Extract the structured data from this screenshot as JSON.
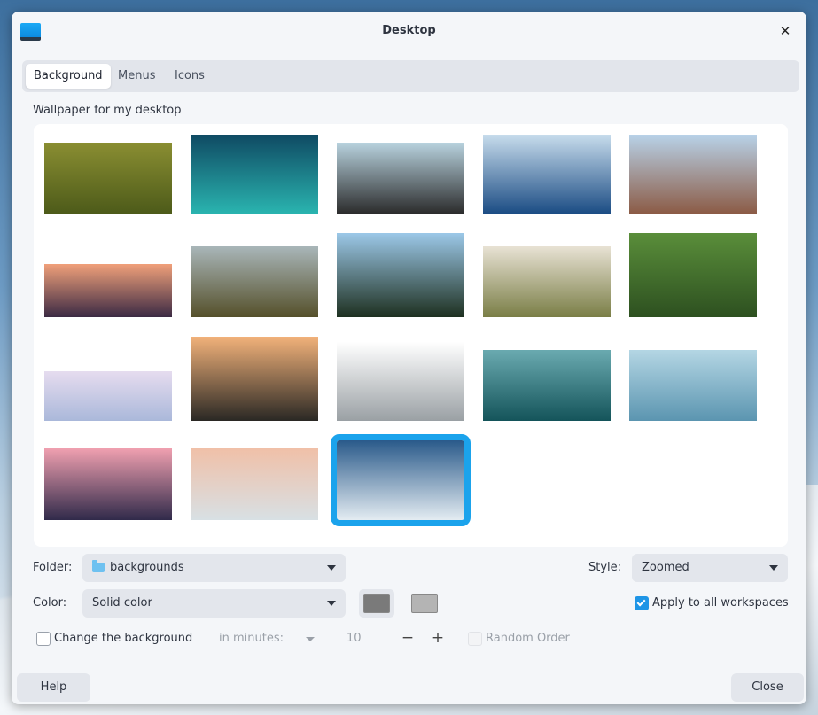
{
  "window": {
    "title": "Desktop",
    "close_glyph": "✕"
  },
  "tabs": [
    {
      "label": "Background",
      "active": true
    },
    {
      "label": "Menus",
      "active": false
    },
    {
      "label": "Icons",
      "active": false
    }
  ],
  "gallery": {
    "label": "Wallpaper for my desktop",
    "selected_index": 17,
    "thumbnails": [
      {
        "name": "green-valley-river",
        "colors": [
          "#8a8e32",
          "#4c5a19"
        ]
      },
      {
        "name": "aurora",
        "colors": [
          "#0f4a63",
          "#2ab5b0"
        ]
      },
      {
        "name": "black-sand-beach",
        "colors": [
          "#b8d2de",
          "#2a2a2a"
        ]
      },
      {
        "name": "ocean-horizon",
        "colors": [
          "#c7dcec",
          "#1a4b83"
        ]
      },
      {
        "name": "desert-buttes-snow",
        "colors": [
          "#b8d2e8",
          "#8b5a44"
        ]
      },
      {
        "name": "city-skyline-sunset",
        "colors": [
          "#f0a07a",
          "#3b2a44"
        ]
      },
      {
        "name": "canyon-waterfall",
        "colors": [
          "#a9b6b9",
          "#55502a"
        ]
      },
      {
        "name": "palm-fronds-sky",
        "colors": [
          "#9cc8e8",
          "#1e3020"
        ]
      },
      {
        "name": "misty-hills",
        "colors": [
          "#e8e2d4",
          "#7a7e46"
        ]
      },
      {
        "name": "green-leaf",
        "colors": [
          "#5a8e3a",
          "#2d5020"
        ]
      },
      {
        "name": "pastel-clouds",
        "colors": [
          "#e6dcef",
          "#aab8da"
        ]
      },
      {
        "name": "mountain-silhouette-dusk",
        "colors": [
          "#f2b27a",
          "#2a2824"
        ]
      },
      {
        "name": "honeycomb-architecture",
        "colors": [
          "#ffffff",
          "#9aa0a4"
        ]
      },
      {
        "name": "teal-waves",
        "colors": [
          "#6aaab0",
          "#14545a"
        ]
      },
      {
        "name": "blue-abstract-swirl",
        "colors": [
          "#b4d6e4",
          "#5b95b0"
        ]
      },
      {
        "name": "lighthouse-pink-sky",
        "colors": [
          "#f0a0b0",
          "#302a4a"
        ]
      },
      {
        "name": "white-dunes-peach",
        "colors": [
          "#f0c0a8",
          "#d8e0e4"
        ]
      },
      {
        "name": "snowy-mountain-peak",
        "colors": [
          "#2a5a8a",
          "#e4ecf2"
        ]
      }
    ]
  },
  "folder": {
    "label": "Folder:",
    "value": "backgrounds"
  },
  "style": {
    "label": "Style:",
    "value": "Zoomed"
  },
  "color": {
    "label": "Color:",
    "value": "Solid color",
    "primary": "#7a7a7a",
    "secondary": "#b4b4b4"
  },
  "apply_all": {
    "label": "Apply to all workspaces",
    "checked": true
  },
  "change_bg": {
    "label": "Change the background",
    "checked": false,
    "interval_label": "in minutes:",
    "minutes": "10",
    "minus": "−",
    "plus": "+",
    "random_label": "Random Order"
  },
  "buttons": {
    "help": "Help",
    "close": "Close"
  },
  "colors": {
    "accent": "#1ba3ec",
    "window_bg": "#f4f6f9"
  }
}
